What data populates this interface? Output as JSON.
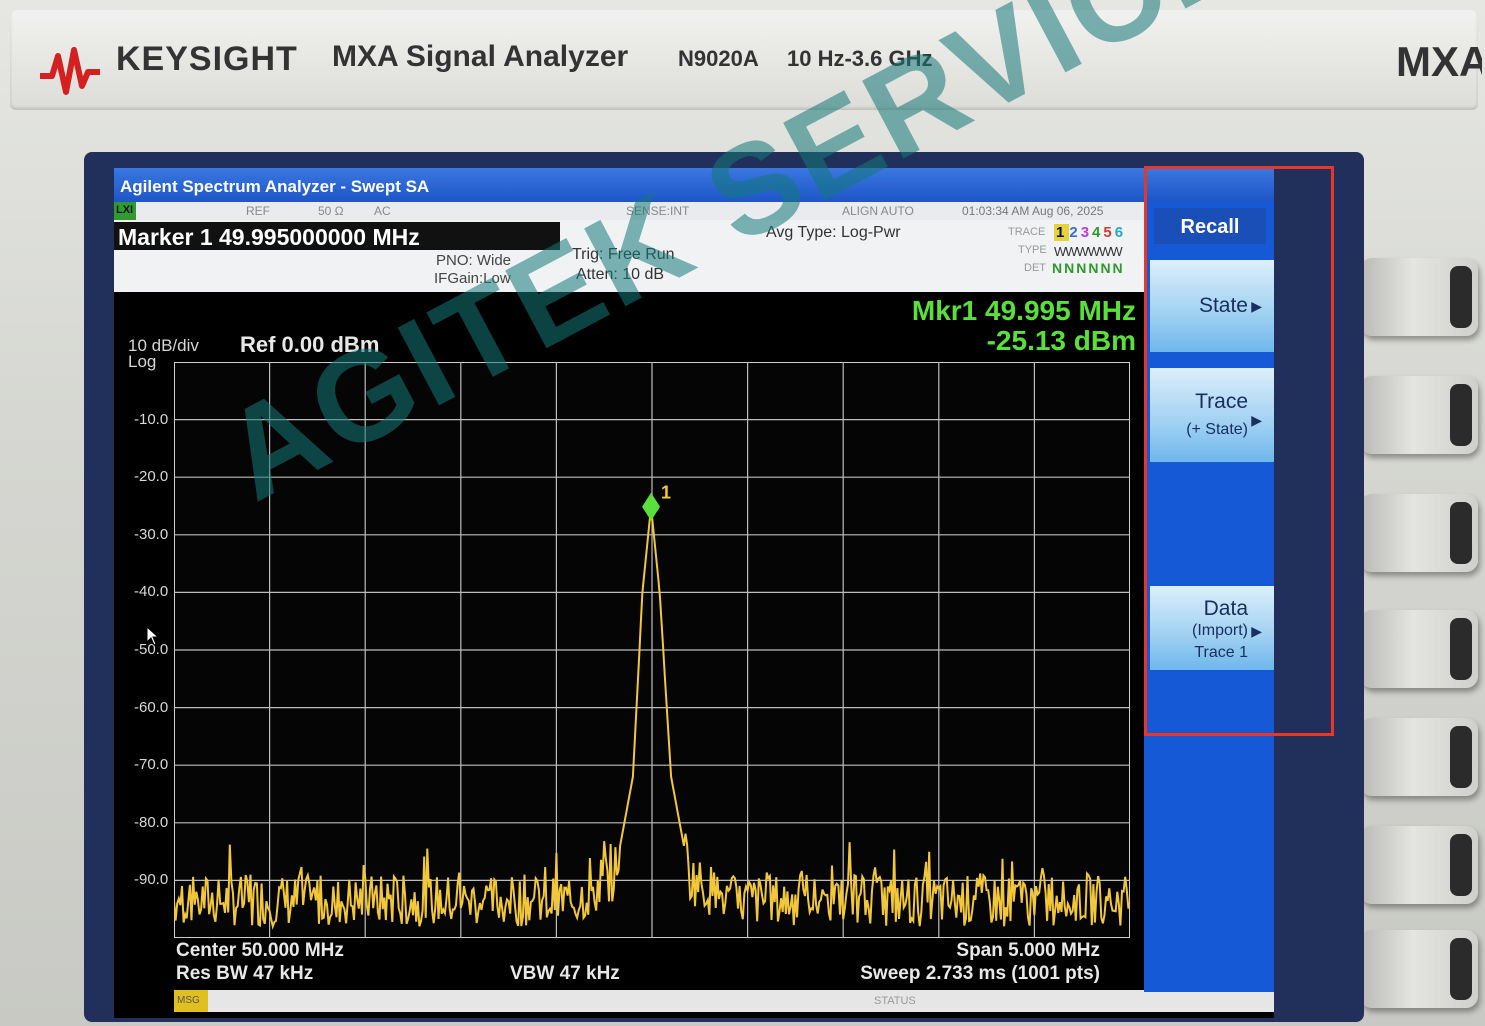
{
  "instrument": {
    "brand": "KEYSIGHT",
    "model_title": "MXA Signal Analyzer",
    "model_number": "N9020A",
    "freq_range": "10 Hz-3.6 GHz",
    "corner_label": "MXA"
  },
  "app": {
    "title": "Agilent Spectrum Analyzer - Swept SA"
  },
  "status_row": {
    "lxi": "LXI",
    "ref": "REF",
    "impedance": "50 Ω",
    "coupling": "AC",
    "sense": "SENSE:INT",
    "align": "ALIGN AUTO",
    "timestamp": "01:03:34 AM Aug 06, 2025"
  },
  "info": {
    "marker_line": "Marker 1 49.995000000 MHz",
    "pno": "PNO: Wide",
    "ifgain": "IFGain:Low",
    "trig": "Trig: Free Run",
    "atten": "Atten: 10 dB",
    "avg_type": "Avg Type: Log-Pwr",
    "trace_label": "TRACE",
    "type_label": "TYPE",
    "det_label": "DET",
    "trace_numbers": [
      "1",
      "2",
      "3",
      "4",
      "5",
      "6"
    ],
    "trace_type": "WWWWWW",
    "trace_det": "NNNNNN"
  },
  "readout": {
    "mkr_freq": "Mkr1 49.995 MHz",
    "mkr_amp": "-25.13 dBm"
  },
  "scale": {
    "div": "10 dB/div",
    "log": "Log",
    "ref": "Ref 0.00 dBm"
  },
  "bottom": {
    "center": "Center 50.000 MHz",
    "res_bw": "Res BW 47 kHz",
    "vbw": "VBW 47 kHz",
    "span": "Span 5.000 MHz",
    "sweep": "Sweep  2.733 ms (1001 pts)",
    "msg": "MSG",
    "status": "STATUS"
  },
  "softkeys": {
    "title": "Recall",
    "state": "State",
    "trace": "Trace",
    "trace_sub": "(+ State)",
    "data": "Data",
    "data_sub1": "(Import)",
    "data_sub2": "Trace 1"
  },
  "watermark": "AGITEK SERVICE",
  "colors": {
    "trace": "#f2c83a",
    "marker": "#59e03a",
    "softkey_bg": "#1659d6",
    "highlight": "#e8362a"
  },
  "chart_data": {
    "type": "line",
    "title": "",
    "xlabel": "",
    "ylabel": "",
    "ylim": [
      -100,
      0
    ],
    "xlim": [
      47.5,
      52.5
    ],
    "y_ticks": [
      "-10.0",
      "-20.0",
      "-30.0",
      "-40.0",
      "-50.0",
      "-60.0",
      "-70.0",
      "-80.0",
      "-90.0"
    ],
    "marker": {
      "label": "1",
      "x": 49.995,
      "y": -25.13
    },
    "series": [
      {
        "x": [
          47.5,
          49.6,
          49.8,
          49.9,
          49.95,
          49.995,
          50.04,
          50.1,
          50.2,
          50.4,
          52.5
        ],
        "y": [
          -94,
          -94,
          -90,
          -72,
          -40,
          -25.13,
          -40,
          -72,
          -90,
          -94,
          -94
        ]
      }
    ]
  }
}
